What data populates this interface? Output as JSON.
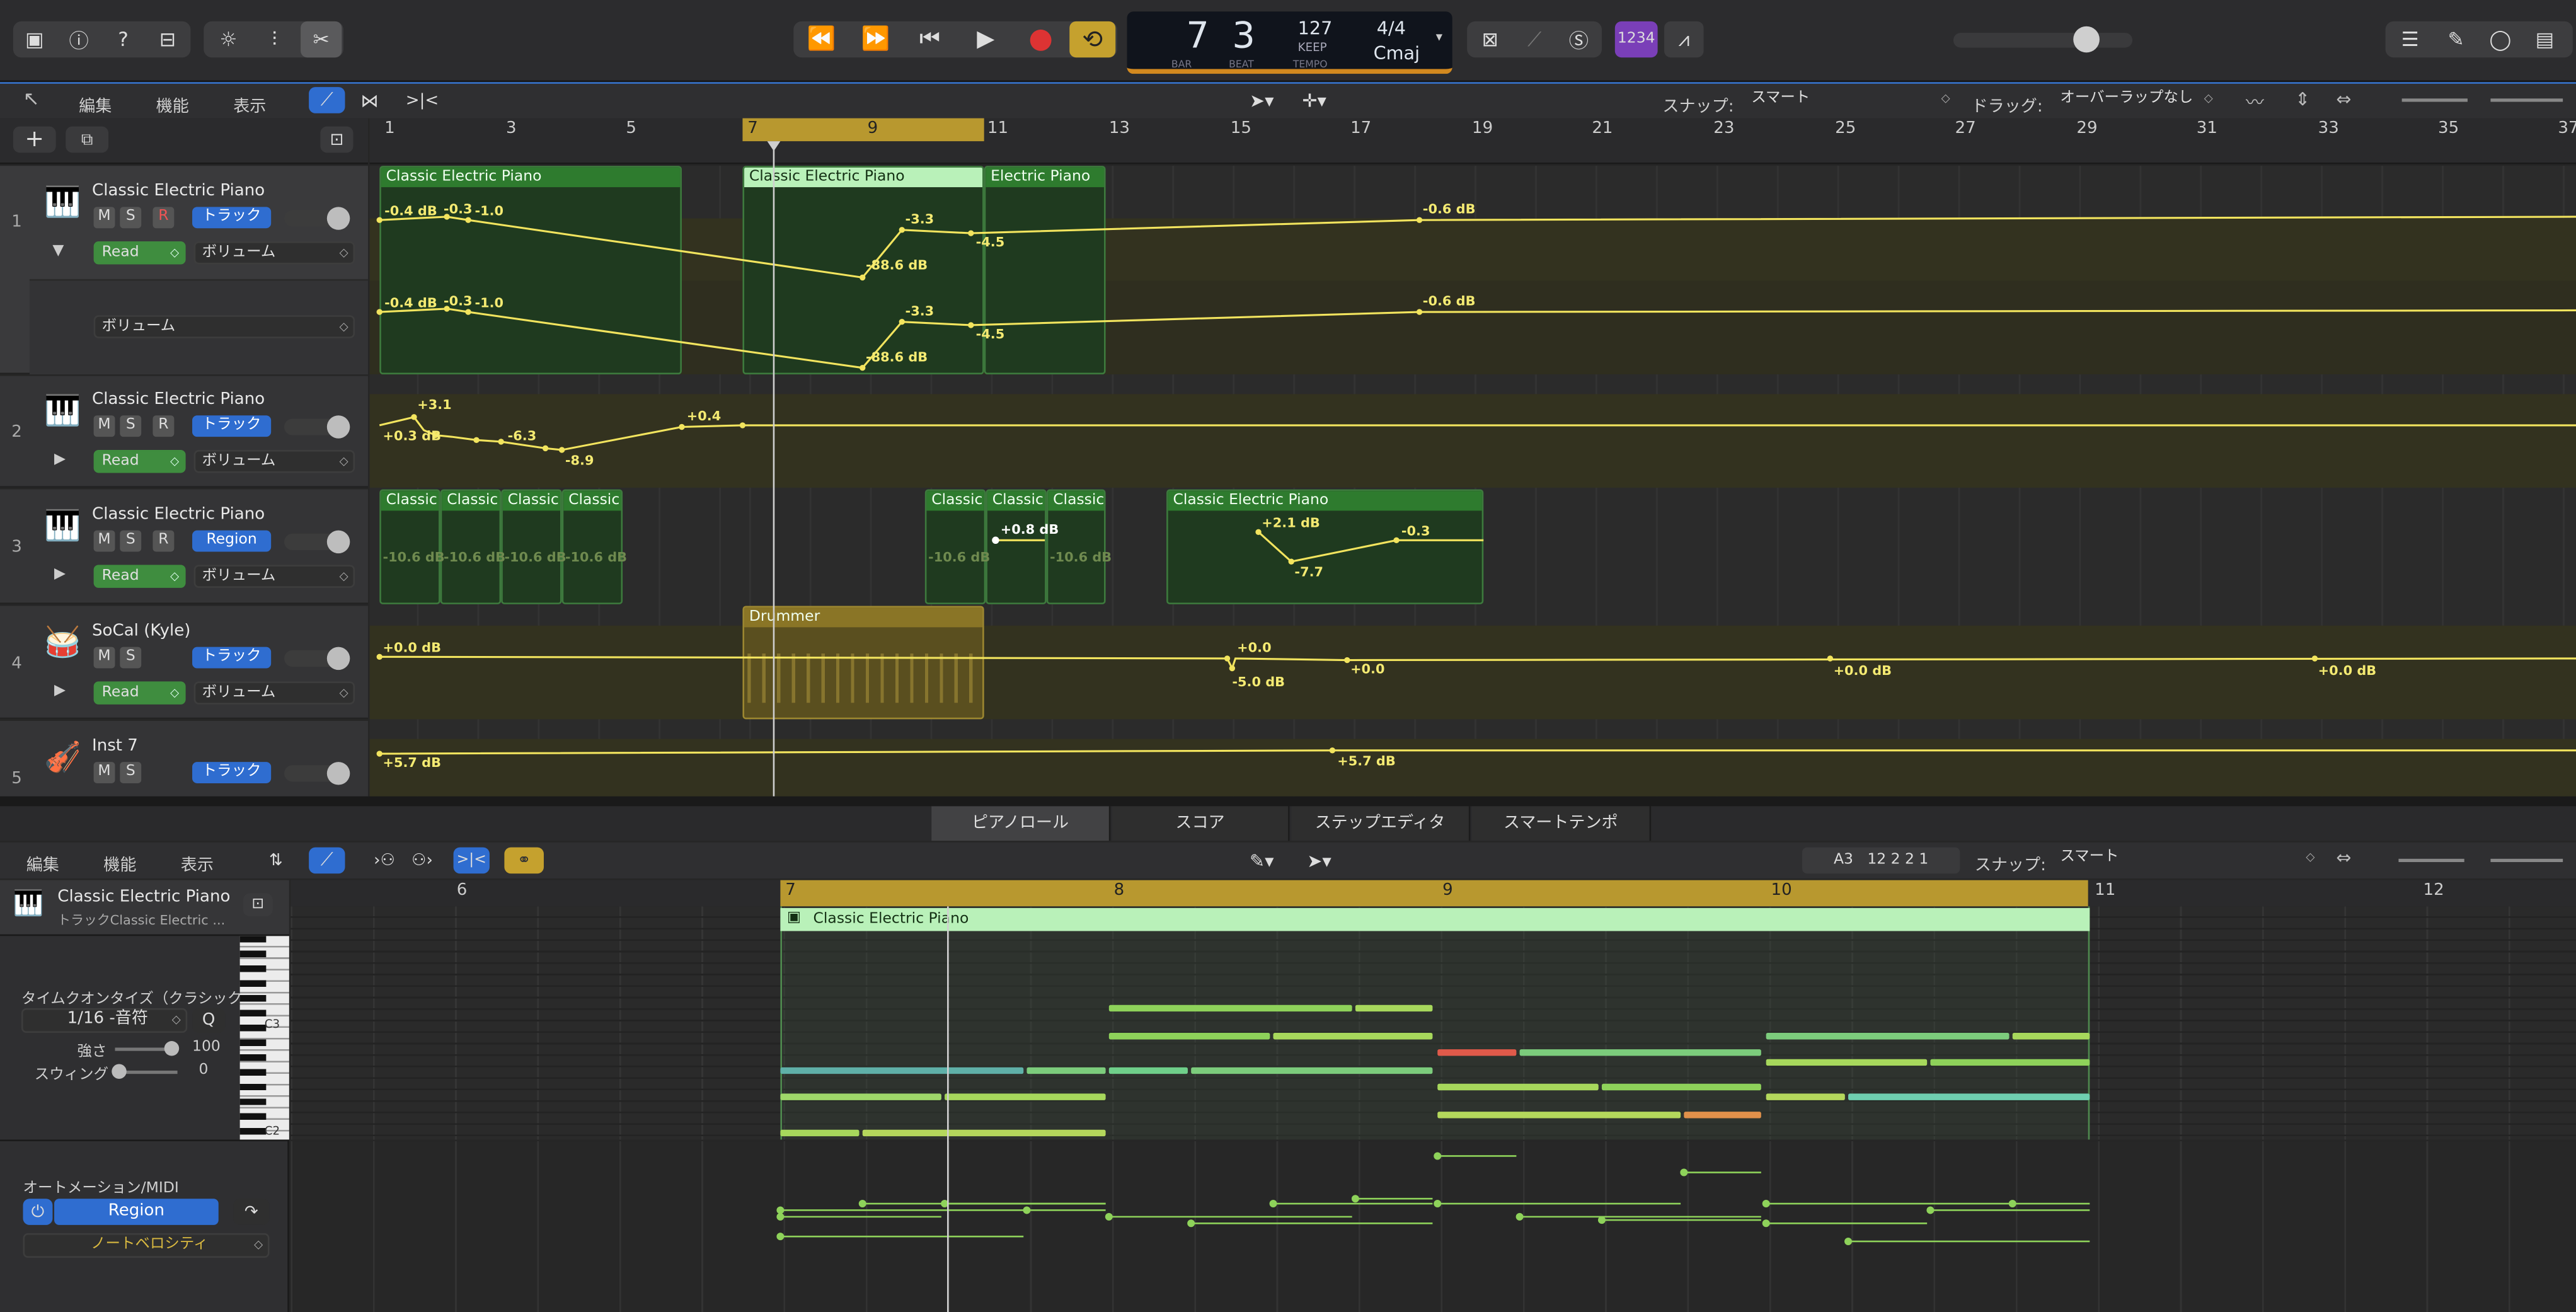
{
  "transport": {
    "bar": "7",
    "beat": "3",
    "bar_label": "BAR",
    "beat_label": "BEAT",
    "tempo": "127",
    "keep": "KEEP",
    "tempo_label": "TEMPO",
    "signature": "4/4",
    "key": "Cmaj",
    "mode_badge": "1234"
  },
  "arrange_menu": {
    "edit": "編集",
    "function": "機能",
    "view": "表示",
    "snap_label": "スナップ:",
    "snap_value": "スマート",
    "drag_label": "ドラッグ:",
    "drag_value": "オーバーラップなし"
  },
  "ruler": [
    "1",
    "3",
    "5",
    "7",
    "9",
    "11",
    "13",
    "15",
    "17",
    "19",
    "21",
    "23",
    "25",
    "27",
    "29",
    "31",
    "33",
    "35",
    "37"
  ],
  "tracks": [
    {
      "num": "1",
      "name": "Classic Electric Piano",
      "mode": "Read",
      "param": "ボリューム",
      "group": "トラック",
      "sub_param": "ボリューム"
    },
    {
      "num": "2",
      "name": "Classic Electric Piano",
      "mode": "Read",
      "param": "ボリューム",
      "group": "トラック"
    },
    {
      "num": "3",
      "name": "Classic Electric Piano",
      "mode": "Read",
      "param": "ボリューム",
      "group": "Region"
    },
    {
      "num": "4",
      "name": "SoCal (Kyle)",
      "mode": "Read",
      "param": "ボリューム",
      "group": "トラック"
    },
    {
      "num": "5",
      "name": "Inst 7",
      "group": "トラック"
    }
  ],
  "msr": {
    "m": "M",
    "s": "S",
    "r": "R"
  },
  "regions": {
    "cep": "Classic Electric Piano",
    "cep_short": "Classic",
    "cep_cut": "Electric Piano",
    "drummer": "Drummer"
  },
  "auto": {
    "t1": [
      "-0.4 dB",
      "-0.3",
      "-1.0",
      "-88.6 dB",
      "-3.3",
      "-4.5",
      "-0.6 dB"
    ],
    "t2": [
      "+3.1",
      "+0.3 dB",
      "-6.3",
      "-8.9",
      "+0.4"
    ],
    "t3": [
      "-10.6 dB",
      "+0.8 dB",
      "+2.1 dB",
      "-7.7",
      "-0.3"
    ],
    "t4": [
      "+0.0 dB",
      "+0.0",
      "-5.0 dB",
      "+0.0",
      "+0.0 dB",
      "+0.0 dB"
    ],
    "t5": [
      "+5.7 dB",
      "+5.7 dB"
    ]
  },
  "editor": {
    "tabs": [
      "ピアノロール",
      "スコア",
      "ステップエディタ",
      "スマートテンポ"
    ],
    "menu": {
      "edit": "編集",
      "function": "機能",
      "view": "表示"
    },
    "position": "A3   12 2 2 1",
    "snap_label": "スナップ:",
    "snap_value": "スマート",
    "region_name": "Classic Electric Piano",
    "region_sub": "トラックClassic Electric ...",
    "ruler": [
      "6",
      "7",
      "8",
      "9",
      "10",
      "11",
      "12"
    ],
    "quantize_label": "タイムクオンタイズ（クラシック）",
    "quantize_value": "1/16 -音符",
    "q": "Q",
    "strength_label": "強さ",
    "strength_value": "100",
    "swing_label": "スウィング",
    "swing_value": "0",
    "keys": [
      "C3",
      "C2"
    ],
    "automation_label": "オートメーション/MIDI",
    "automation_mode": "Region",
    "automation_param": "ノートベロシティ"
  }
}
